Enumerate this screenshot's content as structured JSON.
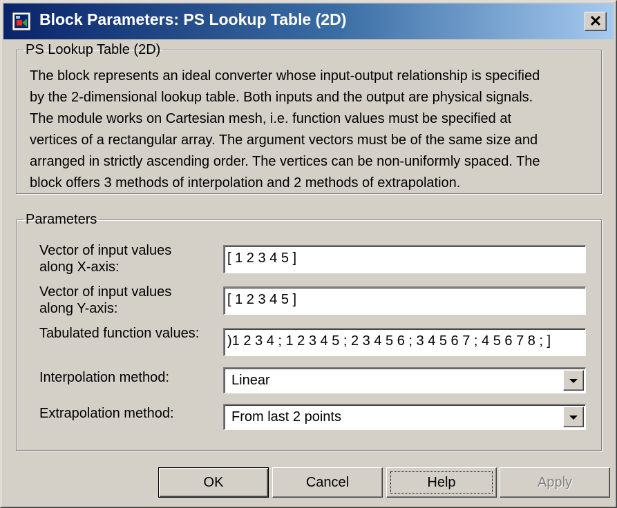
{
  "window": {
    "title": "Block Parameters: PS Lookup Table (2D)",
    "close_label": "✕"
  },
  "description_group": {
    "legend": "PS Lookup Table (2D)",
    "lines": [
      "The block represents an ideal converter whose input-output relationship is specified",
      "by the 2-dimensional lookup table. Both inputs and the output are physical signals.",
      "The module works on Cartesian mesh, i.e. function values must be specified at",
      "vertices of a rectangular array. The argument vectors must be of the same size and",
      "arranged in strictly ascending order. The vertices can be non-uniformly spaced. The",
      "block offers 3 methods of interpolation and 2 methods of extrapolation."
    ]
  },
  "parameters": {
    "legend": "Parameters",
    "x_vector": {
      "label_line1": "Vector of input values",
      "label_line2": "along X-axis:",
      "value": "[ 1 2 3 4 5 ]"
    },
    "y_vector": {
      "label_line1": "Vector of input values",
      "label_line2": "along Y-axis:",
      "value": "[ 1 2 3 4 5 ]"
    },
    "table": {
      "label": "Tabulated function values:",
      "value": ")1 2 3 4 ; 1 2 3 4 5 ; 2 3 4 5 6 ; 3 4 5 6 7 ; 4 5 6 7 8 ; ]"
    },
    "interpolation": {
      "label": "Interpolation method:",
      "value": "Linear"
    },
    "extrapolation": {
      "label": "Extrapolation method:",
      "value": "From last 2 points"
    }
  },
  "buttons": {
    "ok": "OK",
    "cancel": "Cancel",
    "help": "Help",
    "apply": "Apply"
  },
  "icons": {
    "window_icon": "simulink-block-icon",
    "dropdown": "chevron-down-icon"
  },
  "colors": {
    "title_start": "#0a246a",
    "title_end": "#a6caf0",
    "face": "#d4d0c8"
  }
}
